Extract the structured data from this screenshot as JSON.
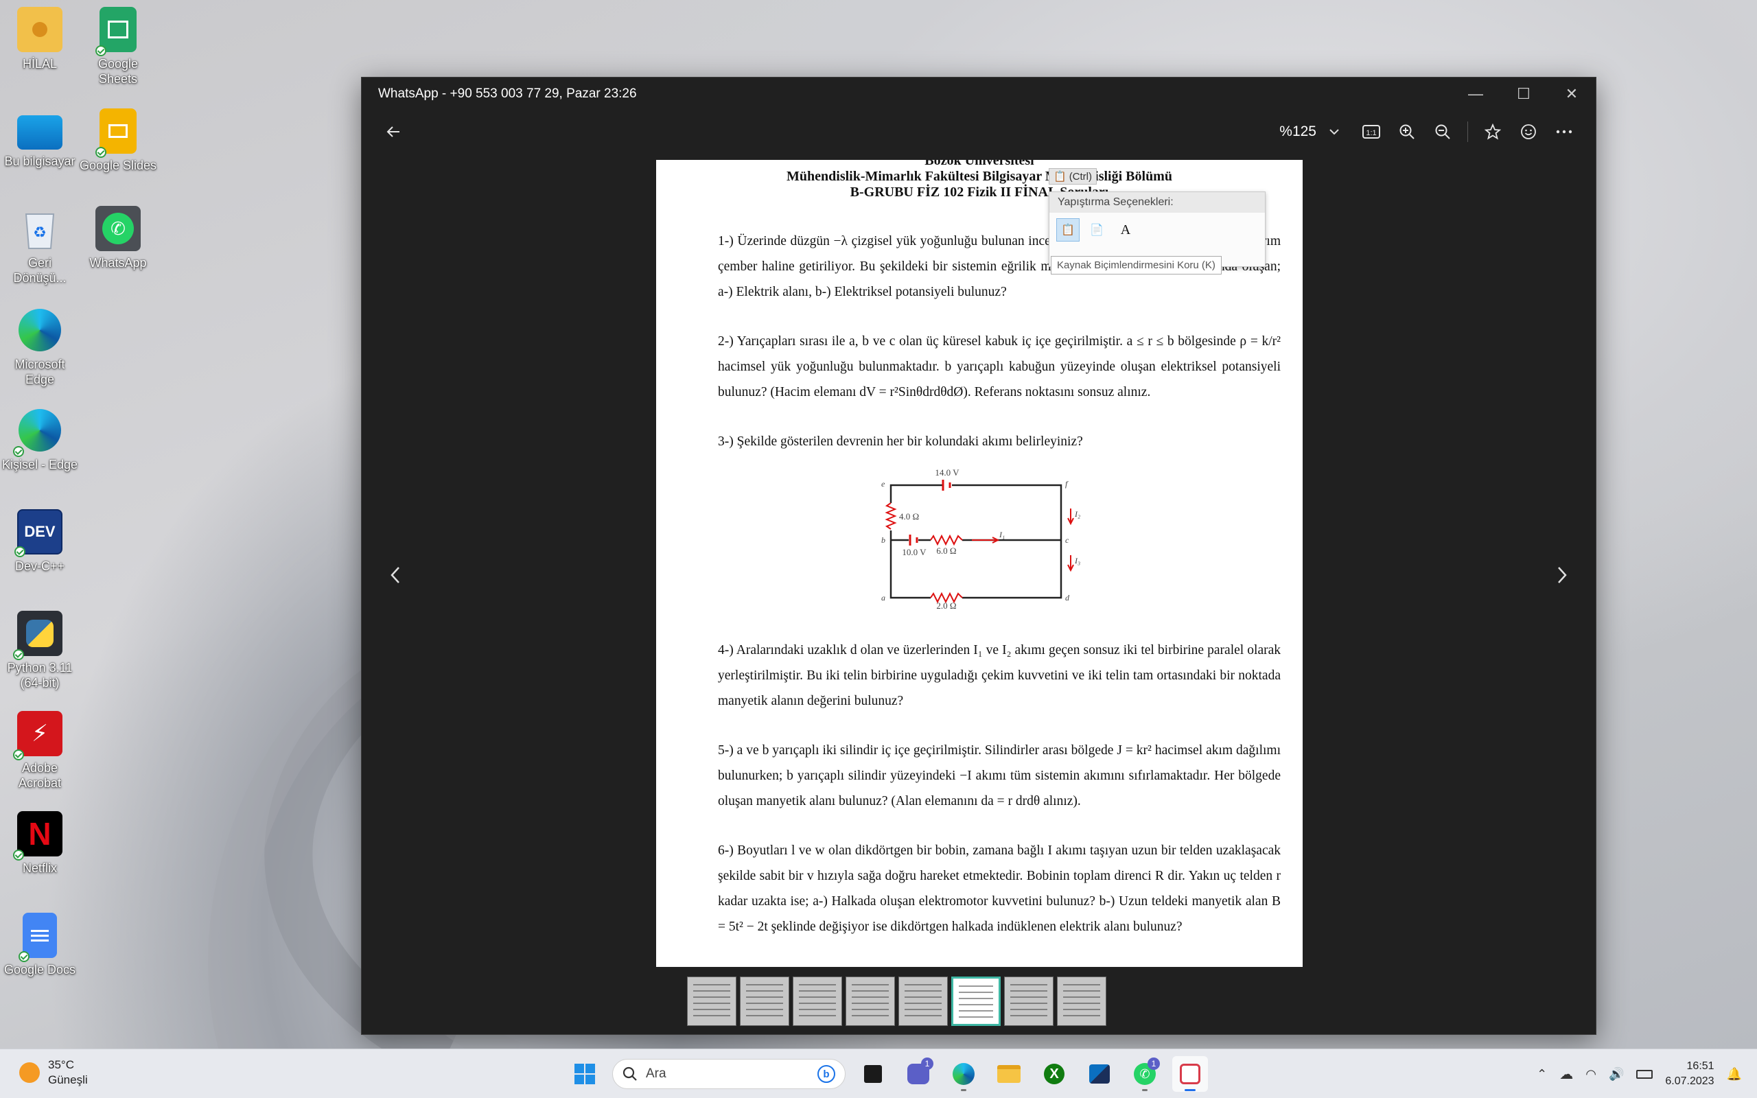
{
  "desktop": {
    "icons": [
      {
        "label": "HİLAL",
        "icon": "folder-user-icon"
      },
      {
        "label": "Google Sheets",
        "icon": "google-sheets-icon"
      },
      {
        "label": "Bu bilgisayar",
        "icon": "this-pc-icon"
      },
      {
        "label": "Google Slides",
        "icon": "google-slides-icon"
      },
      {
        "label": "Geri Dönüşü...",
        "icon": "recycle-bin-icon"
      },
      {
        "label": "WhatsApp",
        "icon": "whatsapp-icon"
      },
      {
        "label": "Microsoft Edge",
        "icon": "edge-icon"
      },
      {
        "label": "Kişisel - Edge",
        "icon": "edge-personal-icon"
      },
      {
        "label": "Dev-C++",
        "icon": "devcpp-icon"
      },
      {
        "label": "Python 3.11 (64-bit)",
        "icon": "python-icon"
      },
      {
        "label": "Adobe Acrobat",
        "icon": "acrobat-icon"
      },
      {
        "label": "Netflix",
        "icon": "netflix-icon"
      },
      {
        "label": "Google Docs",
        "icon": "google-docs-icon"
      }
    ]
  },
  "viewer": {
    "title": "WhatsApp - +90 553 003 77 29, Pazar 23:26",
    "zoom": "%125",
    "toolbar_icons": [
      "actual-size-icon",
      "zoom-in-icon",
      "zoom-out-icon",
      "star-icon",
      "emoji-icon",
      "more-icon"
    ]
  },
  "document": {
    "header_top": "Bozok Üniversitesi",
    "header_1": "Mühendislik-Mimarlık Fakültesi Bilgisayar Mühendisliği Bölümü",
    "header_2": "B-GRUBU FİZ 102 Fizik II FİNAL Soruları",
    "q1": "1-) Üzerinde düzgün −λ çizgisel yük yoğunluğu bulunan ince bir çubuk bükülerek R yarıçaplı bir yarım çember haline getiriliyor. Bu şekildeki bir sistemin eğrilik merkezine konulan bir P noktasında oluşan; a-) Elektrik alanı, b-) Elektriksel potansiyeli bulunuz?",
    "q2": "2-) Yarıçapları sırası ile a, b ve c olan üç küresel kabuk iç içe geçirilmiştir. a ≤ r ≤ b bölgesinde ρ = k/r² hacimsel yük yoğunluğu bulunmaktadır. b yarıçaplı kabuğun yüzeyinde oluşan elektriksel potansiyeli bulunuz? (Hacim elemanı dV = r²SinθdrdθdØ). Referans noktasını sonsuz alınız.",
    "q3": "3-) Şekilde gösterilen devrenin her bir kolundaki akımı belirleyiniz?",
    "q4": "4-) Aralarındaki uzaklık d olan ve üzerlerinden I₁ ve I₂ akımı geçen sonsuz iki tel birbirine paralel olarak yerleştirilmiştir. Bu iki telin birbirine uyguladığı çekim kuvvetini ve iki telin tam ortasındaki bir noktada manyetik alanın değerini bulunuz?",
    "q5": "5-) a ve b yarıçaplı iki silindir iç içe geçirilmiştir. Silindirler arası bölgede J = kr² hacimsel akım dağılımı bulunurken; b yarıçaplı silindir yüzeyindeki −I akımı tüm sistemin akımını sıfırlamaktadır. Her bölgede oluşan manyetik alanı bulunuz? (Alan elemanını da = r drdθ alınız).",
    "q6": "6-) Boyutları l ve w olan dikdörtgen bir bobin, zamana bağlı I akımı taşıyan uzun bir telden uzaklaşacak şekilde sabit bir v hızıyla sağa doğru hareket etmektedir. Bobinin toplam direnci R dir. Yakın uç telden r kadar uzakta ise; a-) Halkada oluşan elektromotor kuvvetini bulunuz? b-) Uzun teldeki manyetik alan B = 5t² − 2t şeklinde değişiyor ise dikdörtgen halkada indüklenen elektrik alanı bulunuz?",
    "circuit": {
      "v1": "14.0 V",
      "v2": "10.0 V",
      "r1": "4.0 Ω",
      "r2": "6.0 Ω",
      "r3": "2.0 Ω",
      "nodes": [
        "e",
        "f",
        "b",
        "c",
        "a",
        "d"
      ],
      "currents": [
        "I₁",
        "I₂",
        "I₃"
      ]
    }
  },
  "paste_popup": {
    "chip": "(Ctrl)",
    "title": "Yapıştırma Seçenekleri:",
    "tooltip": "Kaynak Biçimlendirmesini Koru (K)"
  },
  "thumbnails_count": 8,
  "taskbar": {
    "temp": "35°C",
    "weather": "Güneşli",
    "search_placeholder": "Ara",
    "time": "16:51",
    "date": "6.07.2023",
    "teams_badge": "1",
    "whatsapp_badge": "1"
  }
}
